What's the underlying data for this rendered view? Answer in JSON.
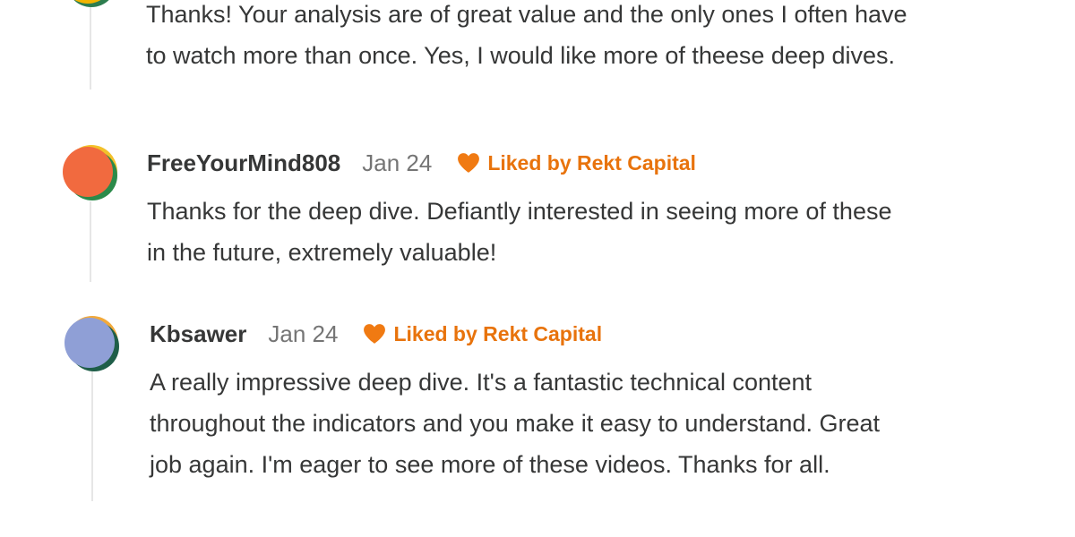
{
  "colors": {
    "accent": "#e8730c",
    "text": "#363737",
    "muted": "#757575",
    "thread_line": "#e6e6e6"
  },
  "comments": [
    {
      "avatar_icon": "user-avatar-icon",
      "body_lines": [
        "Thanks! Your analysis are of great value and the only ones I often have",
        "to watch more than once. Yes, I would like more of theese deep dives."
      ]
    },
    {
      "author": "FreeYourMind808",
      "date": "Jan 24",
      "liked_icon": "heart-icon",
      "liked_label": "Liked by Rekt Capital",
      "avatar_icon": "user-avatar-icon",
      "body_lines": [
        "Thanks for the deep dive. Defiantly interested in seeing more of these",
        "in the future, extremely valuable!"
      ]
    },
    {
      "author": "Kbsawer",
      "date": "Jan 24",
      "liked_icon": "heart-icon",
      "liked_label": "Liked by Rekt Capital",
      "avatar_icon": "user-avatar-icon",
      "body_lines": [
        "A really impressive deep dive. It's a fantastic technical content",
        "throughout the indicators and you make it easy to understand. Great",
        "job again. I'm eager to see more of these videos. Thanks for all."
      ]
    }
  ]
}
